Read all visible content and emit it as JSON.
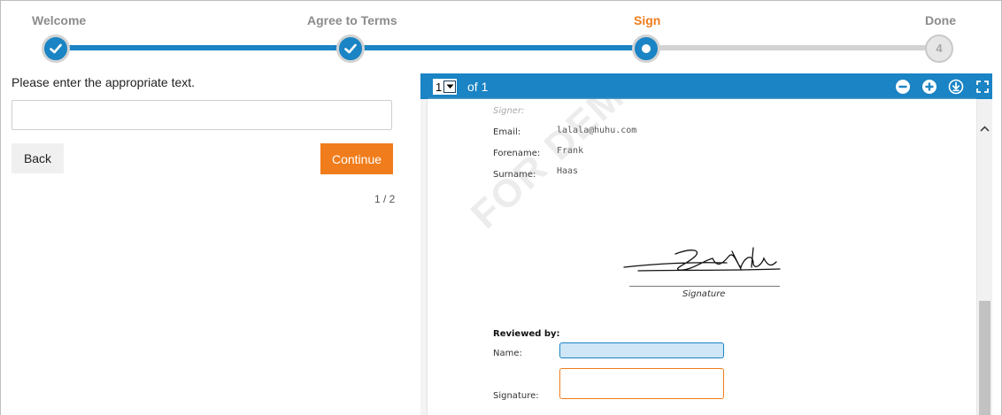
{
  "stepper": {
    "steps": [
      {
        "label": "Welcome",
        "state": "done"
      },
      {
        "label": "Agree to Terms",
        "state": "done"
      },
      {
        "label": "Sign",
        "state": "current"
      },
      {
        "label": "Done",
        "state": "pending",
        "number": "4"
      }
    ],
    "colors": {
      "done": "#1a84c4",
      "active_label": "#f07c1b",
      "pending": "#d3d3d3"
    }
  },
  "left_panel": {
    "prompt": "Please enter the appropriate text.",
    "input_value": "",
    "back_label": "Back",
    "continue_label": "Continue",
    "pager": "1 / 2"
  },
  "viewer": {
    "page_select_value": "1",
    "of_label": "of 1",
    "icons": [
      "zoom-out-icon",
      "zoom-in-icon",
      "download-icon",
      "fullscreen-icon"
    ],
    "document": {
      "signer_heading": "Signer:",
      "email_label": "Email:",
      "email_value": "lalala@huhu.com",
      "forename_label": "Forename:",
      "forename_value": "Frank",
      "surname_label": "Surname:",
      "surname_value": "Haas",
      "signature_caption": "Signature",
      "reviewed_by_label": "Reviewed by:",
      "name_label": "Name:",
      "signature_label": "Signature:",
      "watermark": "FOR DEMO USE"
    }
  }
}
